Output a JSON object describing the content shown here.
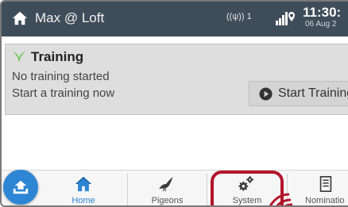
{
  "header": {
    "location": "Max @ Loft",
    "antenna_label": "1",
    "time": "11:30:",
    "date": "06 Aug 2"
  },
  "training": {
    "title": "Training",
    "status_line1": "No training started",
    "status_line2": "Start a training now",
    "start_button_label": "Start Training"
  },
  "tabs": [
    {
      "label": "Home",
      "icon": "home-icon",
      "active": true
    },
    {
      "label": "Pigeons",
      "icon": "pigeon-icon",
      "active": false
    },
    {
      "label": "System",
      "icon": "gears-icon",
      "active": false
    },
    {
      "label": "Nominatio",
      "icon": "document-icon",
      "active": false
    }
  ],
  "colors": {
    "header_bg": "#3f4c59",
    "accent_blue": "#2d85d3",
    "training_icon_green": "#6cc24a",
    "highlight_red": "#b3152a"
  }
}
